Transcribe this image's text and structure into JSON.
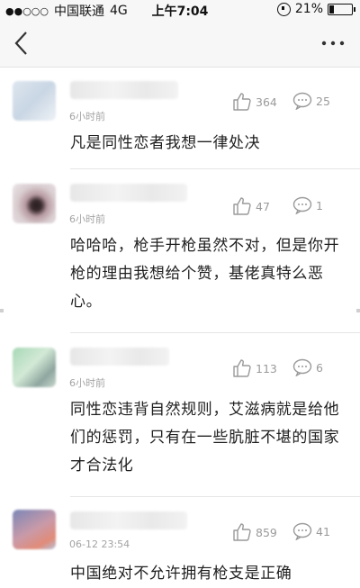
{
  "status_bar": {
    "carrier": "中国联通",
    "network": "4G",
    "time": "上午7:04",
    "battery": "21%"
  },
  "nav": {
    "back_icon": "chevron-left-icon",
    "more_icon": "ellipsis-icon"
  },
  "comments": [
    {
      "time": "6小时前",
      "likes": "364",
      "replies": "25",
      "text": "凡是同性恋者我想一律处决"
    },
    {
      "time": "6小时前",
      "likes": "47",
      "replies": "1",
      "text": "哈哈哈，枪手开枪虽然不对，但是你开枪的理由我想给个赞，基佬真特么恶心。"
    },
    {
      "time": "6小时前",
      "likes": "113",
      "replies": "6",
      "text": "同性恋违背自然规则，艾滋病就是给他们的惩罚，只有在一些肮脏不堪的国家才合法化"
    },
    {
      "time": "06-12 23:54",
      "likes": "859",
      "replies": "41",
      "text": "中国绝对不允许拥有枪支是正确"
    }
  ]
}
